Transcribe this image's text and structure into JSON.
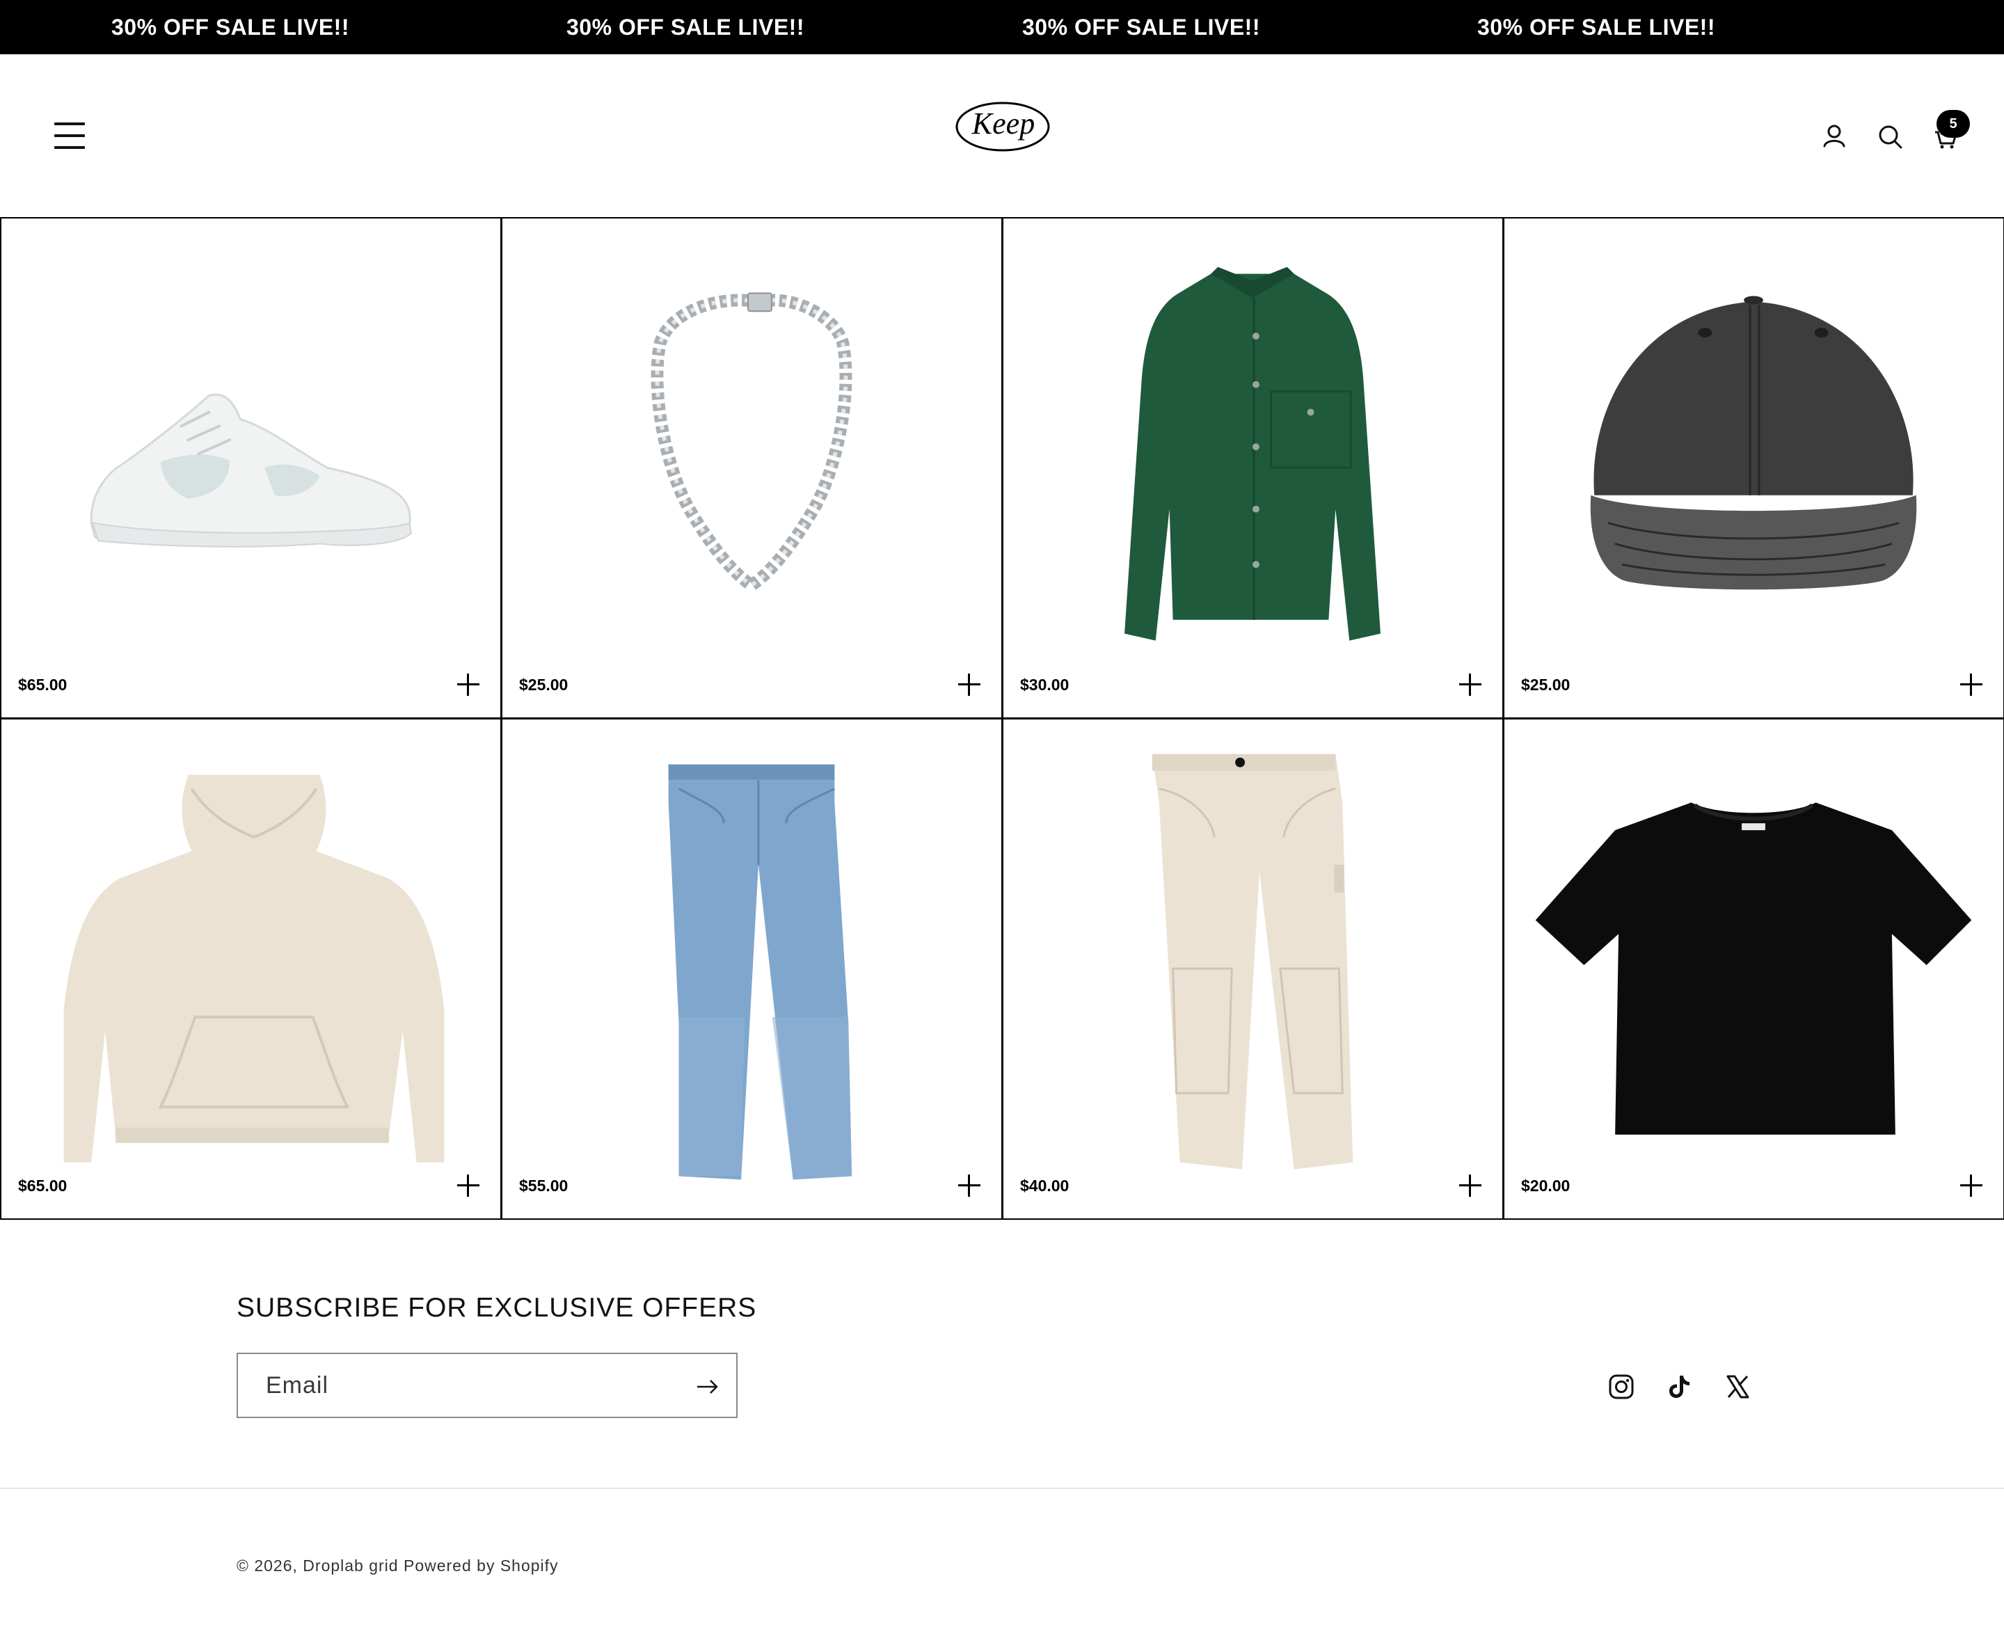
{
  "announcement": {
    "messages": [
      "30% OFF SALE LIVE!!",
      "30% OFF SALE LIVE!!",
      "30% OFF SALE LIVE!!",
      "30% OFF SALE LIVE!!"
    ]
  },
  "header": {
    "logo_text": "Keep",
    "cart_count": "5",
    "icons": [
      "menu-icon",
      "account-icon",
      "search-icon",
      "cart-icon"
    ]
  },
  "products": [
    {
      "name": "white-sneaker",
      "price": "$65.00"
    },
    {
      "name": "silver-chain-necklace",
      "price": "$25.00"
    },
    {
      "name": "green-overshirt",
      "price": "$30.00"
    },
    {
      "name": "washed-black-cap",
      "price": "$25.00"
    },
    {
      "name": "cream-hoodie",
      "price": "$65.00"
    },
    {
      "name": "blue-jeans",
      "price": "$55.00"
    },
    {
      "name": "ecru-carpenter-pants",
      "price": "$40.00"
    },
    {
      "name": "black-tshirt",
      "price": "$20.00"
    }
  ],
  "footer": {
    "subscribe_heading": "SUBSCRIBE FOR EXCLUSIVE OFFERS",
    "email_placeholder": "Email",
    "social_icons": [
      "instagram-icon",
      "tiktok-icon",
      "x-icon"
    ],
    "copyright_year": "© 2026,",
    "store_name": "Droplab grid",
    "powered_by": "Powered by Shopify"
  },
  "colors": {
    "announcement_bg": "#000000",
    "text": "#121212",
    "jacket_green": "#1f5a3c",
    "denim_blue": "#7fa6cc",
    "cream": "#ebe2d4"
  }
}
